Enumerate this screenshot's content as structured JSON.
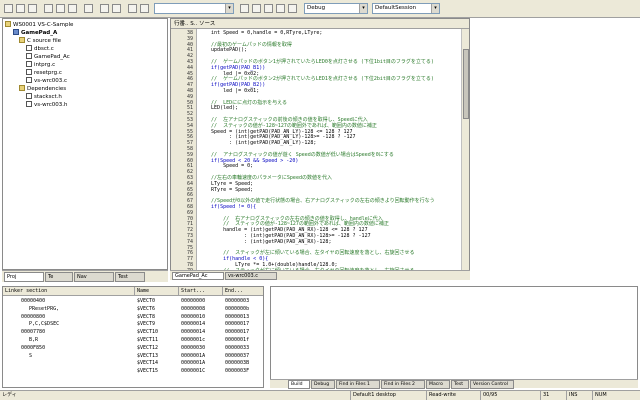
{
  "toolbar": {
    "debug_combo": "Debug",
    "session_combo": "DefaultSession"
  },
  "tree": {
    "workspace": "WS0001 VS-C-Sample",
    "project": "GamePad_A",
    "items": [
      {
        "label": "C source file",
        "indent": 2,
        "icon": "folder"
      },
      {
        "label": "dbsct.c",
        "indent": 3,
        "icon": "file"
      },
      {
        "label": "GamePad_Ac",
        "indent": 3,
        "icon": "file"
      },
      {
        "label": "intprg.c",
        "indent": 3,
        "icon": "file"
      },
      {
        "label": "resetprg.c",
        "indent": 3,
        "icon": "file"
      },
      {
        "label": "vs-wrc003.c",
        "indent": 3,
        "icon": "file"
      },
      {
        "label": "Dependencies",
        "indent": 2,
        "icon": "folder"
      },
      {
        "label": "stacksct.h",
        "indent": 3,
        "icon": "file"
      },
      {
        "label": "vs-wrc003.h",
        "indent": 3,
        "icon": "file"
      }
    ],
    "tabs": [
      "Proj",
      "Te",
      "Nav",
      "Test"
    ]
  },
  "editor": {
    "header": "行番.. S.. ソース",
    "line_numbers": [
      "38",
      "39",
      "40",
      "41",
      "42",
      "43",
      "44",
      "45",
      "46",
      "47",
      "48",
      "49",
      "50",
      "51",
      "52",
      "53",
      "54",
      "55",
      "56",
      "57",
      "58",
      "59",
      "60",
      "61",
      "62",
      "63",
      "64",
      "65",
      "66",
      "67",
      "68",
      "69",
      "70",
      "71",
      "72",
      "73",
      "74",
      "75",
      "76",
      "77",
      "78",
      "79",
      "80"
    ],
    "lines": [
      {
        "text": "    int Speed = 0,handle = 0,RTyre,LTyre;",
        "kind": "normal"
      },
      {
        "text": "",
        "kind": "normal"
      },
      {
        "text": "    //最初のゲームパッドの情報を取得",
        "kind": "comment"
      },
      {
        "text": "    updatePAD();",
        "kind": "normal"
      },
      {
        "text": "",
        "kind": "normal"
      },
      {
        "text": "    //  ゲームパッドのボタン1が押されていたらLED0を点灯させる (下位1bit目のフラグを立てる)",
        "kind": "comment"
      },
      {
        "text": "    if(getPAD(PAD_B1))",
        "kind": "keyword"
      },
      {
        "text": "        led |= 0x02;",
        "kind": "normal"
      },
      {
        "text": "    //  ゲームパッドのボタン2が押されていたらLED1を点灯させる (下位2bit目のフラグを立てる)",
        "kind": "comment"
      },
      {
        "text": "    if(getPAD(PAD_B2))",
        "kind": "keyword"
      },
      {
        "text": "        led |= 0x01;",
        "kind": "normal"
      },
      {
        "text": "",
        "kind": "normal"
      },
      {
        "text": "    //  LEDにに点灯の指示を与える",
        "kind": "comment"
      },
      {
        "text": "    LED(led);",
        "kind": "normal"
      },
      {
        "text": "",
        "kind": "normal"
      },
      {
        "text": "    //  左アナログスティックの前後の傾きの値を取得し、Speedに代入",
        "kind": "comment"
      },
      {
        "text": "    //  スティックの値が-128~127の範囲外であれば、範囲内の数値に補正",
        "kind": "comment"
      },
      {
        "text": "    Speed = (int)getPAD(PAD_AN_LY)-128 <= 128 ? 127",
        "kind": "normal"
      },
      {
        "text": "          : (int)getPAD(PAD_AN_LY)-128>= -128 ? -127",
        "kind": "normal"
      },
      {
        "text": "          : (int)getPAD(PAD_AN_LY)-128;",
        "kind": "normal"
      },
      {
        "text": "",
        "kind": "normal"
      },
      {
        "text": "    //  アナログスティックの値が遊く Speedの数値が低い場合はSpeedを0にする",
        "kind": "comment"
      },
      {
        "text": "    if(Speed < 20 && Speed > -20)",
        "kind": "keyword"
      },
      {
        "text": "        Speed = 0;",
        "kind": "normal"
      },
      {
        "text": "",
        "kind": "normal"
      },
      {
        "text": "    //左右の車輪速度のパラメータにSpeedの数値を代入",
        "kind": "comment"
      },
      {
        "text": "    LTyre = Speed;",
        "kind": "normal"
      },
      {
        "text": "    RTyre = Speed;",
        "kind": "normal"
      },
      {
        "text": "",
        "kind": "normal"
      },
      {
        "text": "    //Speedが0以外の値で走行状態の場合、右アナログスティックの左右の傾きより回転動作を行なう",
        "kind": "comment"
      },
      {
        "text": "    if(Speed != 0){",
        "kind": "keyword"
      },
      {
        "text": "",
        "kind": "normal"
      },
      {
        "text": "        //  右アナログスティックの左右の傾きの値を取得し、handleに代入",
        "kind": "comment"
      },
      {
        "text": "        //  スティックの値が-128~127の範囲外であれば、範囲内の数値に補正",
        "kind": "comment"
      },
      {
        "text": "        handle = (int)getPAD(PAD_AN_RX)-128 <= 128 ? 127",
        "kind": "normal"
      },
      {
        "text": "               : (int)getPAD(PAD_AN_RX)-128>= -128 ? -127",
        "kind": "normal"
      },
      {
        "text": "               : (int)getPAD(PAD_AN_RX)-128;",
        "kind": "normal"
      },
      {
        "text": "",
        "kind": "normal"
      },
      {
        "text": "        //  スティックが左に傾いている場合、左タイヤの回転速度を落とし、右旋回させる",
        "kind": "comment"
      },
      {
        "text": "        if(handle < 0){",
        "kind": "keyword"
      },
      {
        "text": "            LTyre *= 1.0+(double)handle/128.0;",
        "kind": "normal"
      },
      {
        "text": "        //  スティックが右に傾いている場合、右タイヤの回転速度を落とし、左旋回させる",
        "kind": "comment"
      },
      {
        "text": "        }else{",
        "kind": "keyword"
      }
    ],
    "tabs": [
      "GamePad_Ac",
      "vs-wrc003.c"
    ]
  },
  "linker": {
    "headers": [
      "Linker section",
      "Name",
      "Start...",
      "End..."
    ],
    "tree": [
      {
        "label": "00000400",
        "indent": 1
      },
      {
        "label": "PResetPRG,",
        "indent": 2
      },
      {
        "label": "00000800",
        "indent": 1
      },
      {
        "label": "P,C,C$DSEC",
        "indent": 2
      },
      {
        "label": "00007780",
        "indent": 1
      },
      {
        "label": "B,R",
        "indent": 2
      },
      {
        "label": "0000F850",
        "indent": 1
      },
      {
        "label": "S",
        "indent": 2
      }
    ],
    "rows": [
      {
        "name": "$VECT0",
        "start": "00000000",
        "end": "00000003"
      },
      {
        "name": "$VECT6",
        "start": "00000008",
        "end": "0000000b"
      },
      {
        "name": "$VECT8",
        "start": "00000010",
        "end": "00000013"
      },
      {
        "name": "$VECT9",
        "start": "00000014",
        "end": "00000017"
      },
      {
        "name": "$VECT10",
        "start": "00000014",
        "end": "00000017"
      },
      {
        "name": "$VECT11",
        "start": "0000001c",
        "end": "0000001f"
      },
      {
        "name": "$VECT12",
        "start": "00000030",
        "end": "00000033"
      },
      {
        "name": "$VECT13",
        "start": "0000001A",
        "end": "00000037"
      },
      {
        "name": "$VECT14",
        "start": "0000001A",
        "end": "0000003B"
      },
      {
        "name": "$VECT15",
        "start": "0000001C",
        "end": "0000003F"
      }
    ]
  },
  "output": {
    "tabs": [
      "Build",
      "Debug",
      "Find in Files 1",
      "Find in Files 2",
      "Macro",
      "Test",
      "Version Control"
    ]
  },
  "statusbar": {
    "ready": "レディ",
    "desktop": "Default1 desktop",
    "mode": "Read-write",
    "position": "00/95",
    "col": "31",
    "ins": "INS",
    "num": "NUM"
  }
}
